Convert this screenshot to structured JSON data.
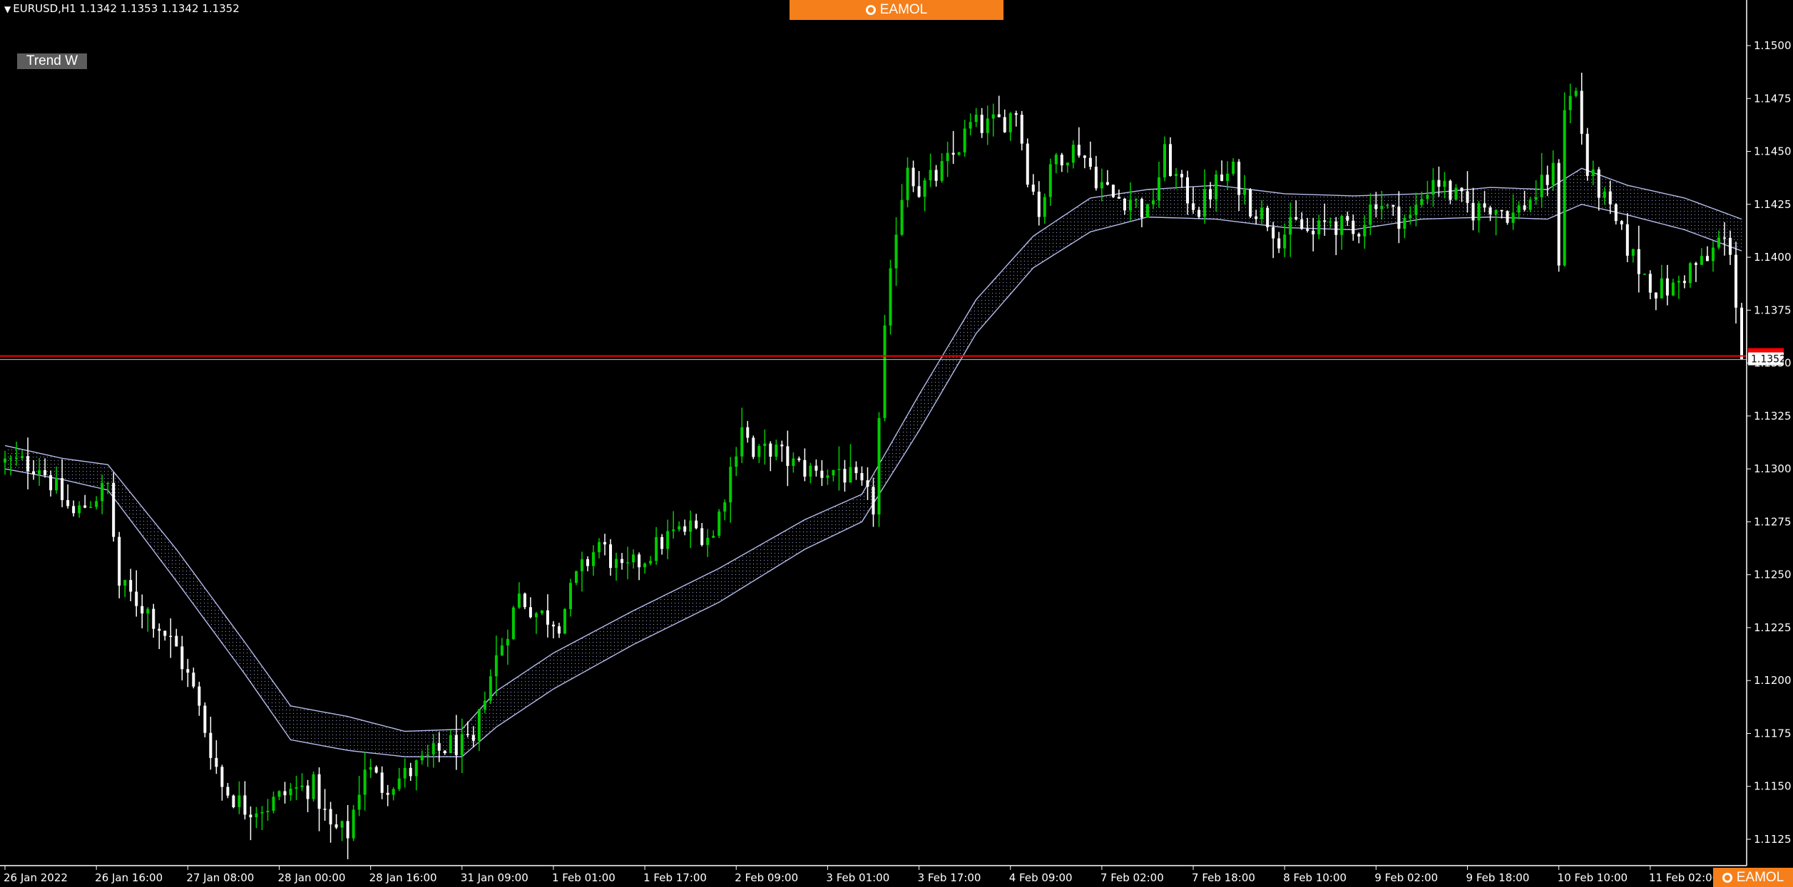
{
  "header": {
    "symbol_line": "EURUSD,H1  1.1342 1.1353 1.1342 1.1352",
    "indicator_label": "Trend W",
    "banner_text": "EAMOL",
    "corner_logo_text": "EAMOL"
  },
  "colors": {
    "background": "#000000",
    "bull_candle": "#00cc00",
    "bear_candle": "#ffffff",
    "band_line": "#b6bdec",
    "price_line": "#ff0000",
    "axis": "#ffffff",
    "banner": "#f57f1a"
  },
  "chart_data": {
    "type": "candlestick",
    "symbol": "EURUSD",
    "timeframe": "H1",
    "ohlc_header": {
      "open": 1.1342,
      "high": 1.1353,
      "low": 1.1342,
      "close": 1.1352
    },
    "current_price": 1.1352,
    "current_price_label": "1.1352",
    "ylim": [
      1.1112,
      1.1518
    ],
    "y_ticks": [
      {
        "value": 1.15,
        "label": "1.1500"
      },
      {
        "value": 1.1475,
        "label": "1.1475"
      },
      {
        "value": 1.145,
        "label": "1.1450"
      },
      {
        "value": 1.1425,
        "label": "1.1425"
      },
      {
        "value": 1.14,
        "label": "1.1400"
      },
      {
        "value": 1.1375,
        "label": "1.1375"
      },
      {
        "value": 1.135,
        "label": "1.1350"
      },
      {
        "value": 1.1325,
        "label": "1.1325"
      },
      {
        "value": 1.13,
        "label": "1.1300"
      },
      {
        "value": 1.1275,
        "label": "1.1275"
      },
      {
        "value": 1.125,
        "label": "1.1250"
      },
      {
        "value": 1.1225,
        "label": "1.1225"
      },
      {
        "value": 1.12,
        "label": "1.1200"
      },
      {
        "value": 1.1175,
        "label": "1.1175"
      },
      {
        "value": 1.115,
        "label": "1.1150"
      },
      {
        "value": 1.1125,
        "label": "1.1125"
      }
    ],
    "x_ticks": [
      {
        "bar": 0,
        "label": "26 Jan 2022"
      },
      {
        "bar": 16,
        "label": "26 Jan 16:00"
      },
      {
        "bar": 32,
        "label": "27 Jan 08:00"
      },
      {
        "bar": 48,
        "label": "28 Jan 00:00"
      },
      {
        "bar": 64,
        "label": "28 Jan 16:00"
      },
      {
        "bar": 80,
        "label": "31 Jan 09:00"
      },
      {
        "bar": 96,
        "label": "1 Feb 01:00"
      },
      {
        "bar": 112,
        "label": "1 Feb 17:00"
      },
      {
        "bar": 128,
        "label": "2 Feb 09:00"
      },
      {
        "bar": 144,
        "label": "3 Feb 01:00"
      },
      {
        "bar": 160,
        "label": "3 Feb 17:00"
      },
      {
        "bar": 176,
        "label": "4 Feb 09:00"
      },
      {
        "bar": 192,
        "label": "7 Feb 02:00"
      },
      {
        "bar": 208,
        "label": "7 Feb 18:00"
      },
      {
        "bar": 224,
        "label": "8 Feb 10:00"
      },
      {
        "bar": 240,
        "label": "9 Feb 02:00"
      },
      {
        "bar": 256,
        "label": "9 Feb 18:00"
      },
      {
        "bar": 272,
        "label": "10 Feb 10:00"
      },
      {
        "bar": 288,
        "label": "11 Feb 02:00"
      }
    ],
    "bar_count": 305,
    "close_keypoints": [
      [
        0,
        1.1303
      ],
      [
        6,
        1.1302
      ],
      [
        12,
        1.1278
      ],
      [
        18,
        1.1292
      ],
      [
        20,
        1.1245
      ],
      [
        25,
        1.1233
      ],
      [
        30,
        1.1215
      ],
      [
        33,
        1.1195
      ],
      [
        36,
        1.1168
      ],
      [
        38,
        1.115
      ],
      [
        42,
        1.114
      ],
      [
        46,
        1.1141
      ],
      [
        50,
        1.1148
      ],
      [
        54,
        1.115
      ],
      [
        57,
        1.113
      ],
      [
        60,
        1.1128
      ],
      [
        63,
        1.116
      ],
      [
        66,
        1.115
      ],
      [
        70,
        1.1155
      ],
      [
        74,
        1.1163
      ],
      [
        78,
        1.117
      ],
      [
        82,
        1.1168
      ],
      [
        84,
        1.1195
      ],
      [
        87,
        1.1218
      ],
      [
        90,
        1.124
      ],
      [
        93,
        1.1232
      ],
      [
        97,
        1.1228
      ],
      [
        100,
        1.1248
      ],
      [
        104,
        1.1265
      ],
      [
        108,
        1.125
      ],
      [
        112,
        1.1258
      ],
      [
        116,
        1.1268
      ],
      [
        120,
        1.1272
      ],
      [
        124,
        1.1268
      ],
      [
        127,
        1.13
      ],
      [
        129,
        1.1322
      ],
      [
        131,
        1.1305
      ],
      [
        134,
        1.131
      ],
      [
        138,
        1.1302
      ],
      [
        142,
        1.1298
      ],
      [
        146,
        1.13
      ],
      [
        150,
        1.129
      ],
      [
        152,
        1.1282
      ],
      [
        154,
        1.1363
      ],
      [
        156,
        1.1415
      ],
      [
        158,
        1.1445
      ],
      [
        160,
        1.1432
      ],
      [
        163,
        1.1438
      ],
      [
        166,
        1.1448
      ],
      [
        169,
        1.1462
      ],
      [
        172,
        1.1462
      ],
      [
        175,
        1.1465
      ],
      [
        177,
        1.147
      ],
      [
        179,
        1.144
      ],
      [
        181,
        1.1422
      ],
      [
        184,
        1.1448
      ],
      [
        188,
        1.1452
      ],
      [
        191,
        1.1438
      ],
      [
        194,
        1.1428
      ],
      [
        197,
        1.1428
      ],
      [
        200,
        1.142
      ],
      [
        203,
        1.1448
      ],
      [
        206,
        1.1432
      ],
      [
        209,
        1.1423
      ],
      [
        212,
        1.1435
      ],
      [
        215,
        1.144
      ],
      [
        218,
        1.1425
      ],
      [
        221,
        1.1418
      ],
      [
        223,
        1.141
      ],
      [
        226,
        1.1415
      ],
      [
        229,
        1.141
      ],
      [
        232,
        1.1418
      ],
      [
        236,
        1.141
      ],
      [
        240,
        1.1428
      ],
      [
        243,
        1.142
      ],
      [
        246,
        1.1418
      ],
      [
        250,
        1.1438
      ],
      [
        253,
        1.143
      ],
      [
        257,
        1.1422
      ],
      [
        260,
        1.1425
      ],
      [
        264,
        1.142
      ],
      [
        268,
        1.143
      ],
      [
        271,
        1.144
      ],
      [
        272,
        1.14
      ],
      [
        273,
        1.1472
      ],
      [
        275,
        1.1478
      ],
      [
        277,
        1.144
      ],
      [
        279,
        1.1432
      ],
      [
        281,
        1.142
      ],
      [
        283,
        1.141
      ],
      [
        286,
        1.1395
      ],
      [
        289,
        1.1385
      ],
      [
        292,
        1.1385
      ],
      [
        295,
        1.1395
      ],
      [
        298,
        1.1398
      ],
      [
        300,
        1.1408
      ],
      [
        302,
        1.1405
      ],
      [
        304,
        1.1352
      ]
    ],
    "band_upper_keypoints": [
      [
        0,
        1.1311
      ],
      [
        10,
        1.1305
      ],
      [
        18,
        1.1302
      ],
      [
        30,
        1.1262
      ],
      [
        42,
        1.1218
      ],
      [
        50,
        1.1188
      ],
      [
        60,
        1.1183
      ],
      [
        70,
        1.1176
      ],
      [
        80,
        1.1177
      ],
      [
        86,
        1.1195
      ],
      [
        96,
        1.1213
      ],
      [
        110,
        1.1233
      ],
      [
        125,
        1.1253
      ],
      [
        140,
        1.1276
      ],
      [
        150,
        1.1288
      ],
      [
        160,
        1.1335
      ],
      [
        170,
        1.138
      ],
      [
        180,
        1.141
      ],
      [
        190,
        1.1428
      ],
      [
        200,
        1.1432
      ],
      [
        212,
        1.1434
      ],
      [
        224,
        1.143
      ],
      [
        236,
        1.1429
      ],
      [
        248,
        1.143
      ],
      [
        260,
        1.1433
      ],
      [
        270,
        1.1432
      ],
      [
        276,
        1.1442
      ],
      [
        284,
        1.1434
      ],
      [
        294,
        1.1428
      ],
      [
        304,
        1.1418
      ]
    ],
    "band_lower_keypoints": [
      [
        0,
        1.13
      ],
      [
        10,
        1.1295
      ],
      [
        18,
        1.129
      ],
      [
        30,
        1.1247
      ],
      [
        42,
        1.1203
      ],
      [
        50,
        1.1172
      ],
      [
        60,
        1.1167
      ],
      [
        70,
        1.1164
      ],
      [
        80,
        1.1164
      ],
      [
        86,
        1.1178
      ],
      [
        96,
        1.1196
      ],
      [
        110,
        1.1217
      ],
      [
        125,
        1.1237
      ],
      [
        140,
        1.1262
      ],
      [
        150,
        1.1275
      ],
      [
        160,
        1.1318
      ],
      [
        170,
        1.1364
      ],
      [
        180,
        1.1395
      ],
      [
        190,
        1.1412
      ],
      [
        200,
        1.1419
      ],
      [
        212,
        1.1418
      ],
      [
        224,
        1.1414
      ],
      [
        236,
        1.1413
      ],
      [
        248,
        1.1418
      ],
      [
        260,
        1.1419
      ],
      [
        270,
        1.1418
      ],
      [
        276,
        1.1425
      ],
      [
        284,
        1.142
      ],
      [
        294,
        1.1413
      ],
      [
        304,
        1.1403
      ]
    ]
  }
}
